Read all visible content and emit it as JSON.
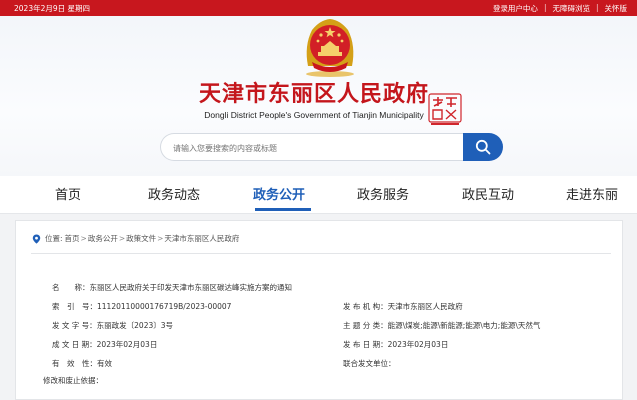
{
  "topbar": {
    "date": "2023年2月9日 星期四",
    "login": "登录用户中心",
    "accessibility": "无障碍浏览",
    "care": "关怀版"
  },
  "header": {
    "title_cn": "天津市东丽区人民政府",
    "title_en": "Dongli District People's Government of Tianjin Municipality"
  },
  "search": {
    "placeholder": "请输入您要搜索的内容或标题"
  },
  "nav": {
    "items": [
      "首页",
      "政务动态",
      "政务公开",
      "政务服务",
      "政民互动",
      "走进东丽"
    ],
    "active_index": 2
  },
  "breadcrumb": {
    "prefix": "位置:",
    "items": [
      "首页",
      "政务公开",
      "政策文件",
      "天津市东丽区人民政府"
    ]
  },
  "document": {
    "name_label": "名　　称：",
    "name_value": "东丽区人民政府关于印发天津市东丽区碳达峰实施方案的通知",
    "index_label": "索　引　号：",
    "index_value": "11120110000176719B/2023-00007",
    "issuer_label": "发 布 机 构：",
    "issuer_value": "天津市东丽区人民政府",
    "doc_no_label": "发 文 字 号：",
    "doc_no_value": "东丽政发〔2023〕3号",
    "category_label": "主 题 分 类：",
    "category_value": "能源\\煤炭;能源\\新能源;能源\\电力;能源\\天然气",
    "created_label": "成 文 日 期：",
    "created_value": "2023年02月03日",
    "published_label": "发 布 日 期：",
    "published_value": "2023年02月03日",
    "validity_label": "有　效　性：",
    "validity_value": "有效",
    "joint_label": "联合发文单位：",
    "basis_label": "修改和废止依据："
  },
  "colors": {
    "brand_red": "#c4161c",
    "accent_blue": "#1f5fb8"
  }
}
